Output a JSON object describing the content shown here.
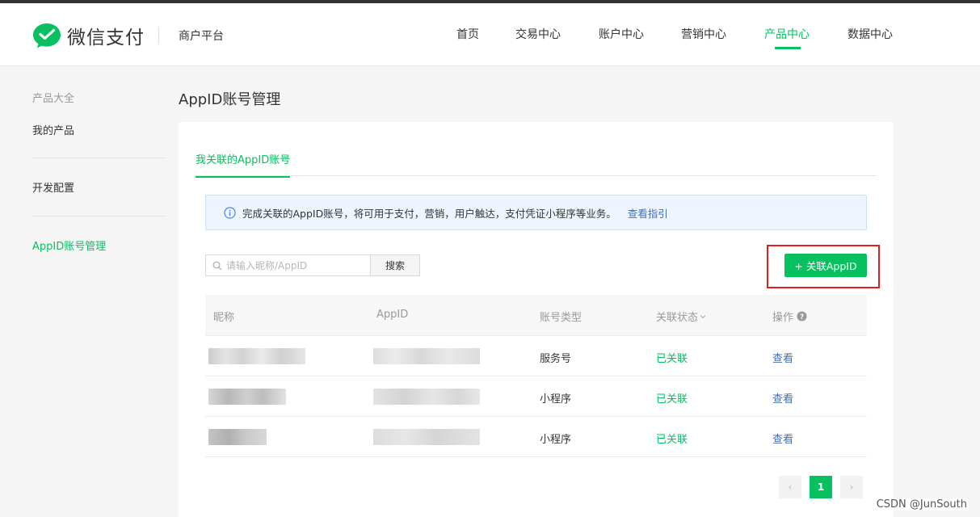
{
  "header": {
    "logo_text": "微信支付",
    "platform": "商户平台",
    "nav": [
      "首页",
      "交易中心",
      "账户中心",
      "营销中心",
      "产品中心",
      "数据中心"
    ],
    "active_nav": "产品中心"
  },
  "sidebar": {
    "group_label": "产品大全",
    "items": [
      "我的产品",
      "开发配置",
      "AppID账号管理"
    ],
    "active_item": "AppID账号管理"
  },
  "main": {
    "title": "AppID账号管理",
    "tab": "我关联的AppID账号",
    "notice": {
      "text": "完成关联的AppID账号，将可用于支付，营销，用户触达，支付凭证小程序等业务。",
      "link": "查看指引"
    },
    "search": {
      "placeholder": "请输入昵称/AppID",
      "button": "搜索"
    },
    "add_button": "+ 关联AppID",
    "table": {
      "headers": [
        "昵称",
        "AppID",
        "账号类型",
        "关联状态",
        "操作"
      ],
      "rows": [
        {
          "type": "服务号",
          "status": "已关联",
          "action": "查看"
        },
        {
          "type": "小程序",
          "status": "已关联",
          "action": "查看"
        },
        {
          "type": "小程序",
          "status": "已关联",
          "action": "查看"
        }
      ]
    },
    "pagination": {
      "current": "1",
      "prev": "‹",
      "next": "›"
    }
  },
  "watermark": "CSDN @JunSouth",
  "colors": {
    "accent": "#07c160",
    "link": "#3f6fb5",
    "highlight": "#e31b1b"
  }
}
